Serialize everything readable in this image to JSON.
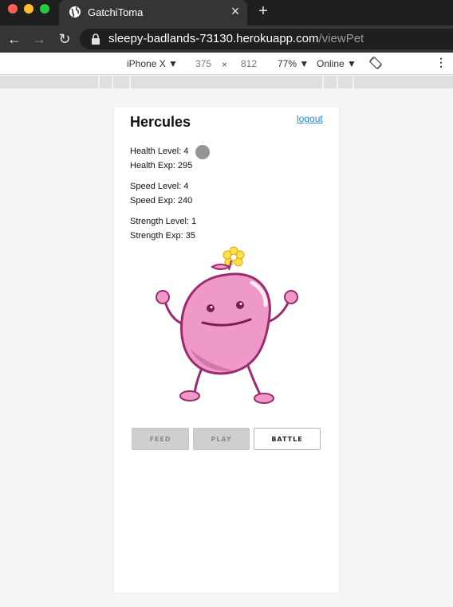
{
  "browser": {
    "tab_title": "GatchiToma",
    "tab_close": "×",
    "new_tab": "+",
    "url_host": "sleepy-badlands-73130.herokuapp.com",
    "url_path": "/viewPet",
    "back_glyph": "←",
    "forward_glyph": "→",
    "reload_glyph": "↻"
  },
  "devtools": {
    "device": "iPhone X ▼",
    "width": "375",
    "times": "×",
    "height": "812",
    "zoom": "77% ▼",
    "network": "Online ▼",
    "more": "⋮"
  },
  "pet": {
    "name": "Hercules",
    "logout": "logout",
    "stats": {
      "health_level": "Health Level: 4",
      "health_exp": "Health Exp: 295",
      "speed_level": "Speed Level: 4",
      "speed_exp": "Speed Exp: 240",
      "strength_level": "Strength Level: 1",
      "strength_exp": "Strength Exp: 35"
    }
  },
  "actions": {
    "feed": "FEED",
    "play": "PLAY",
    "battle": "BATTLE"
  },
  "colors": {
    "pet_body": "#ee99c8",
    "pet_outline": "#9b2a6e",
    "flower": "#ffe14d",
    "link": "#1e88e5"
  },
  "icons": [
    "globe-icon",
    "close-icon",
    "plus-icon",
    "back-arrow-icon",
    "forward-arrow-icon",
    "reload-icon",
    "lock-icon",
    "rotate-icon",
    "more-vertical-icon"
  ]
}
